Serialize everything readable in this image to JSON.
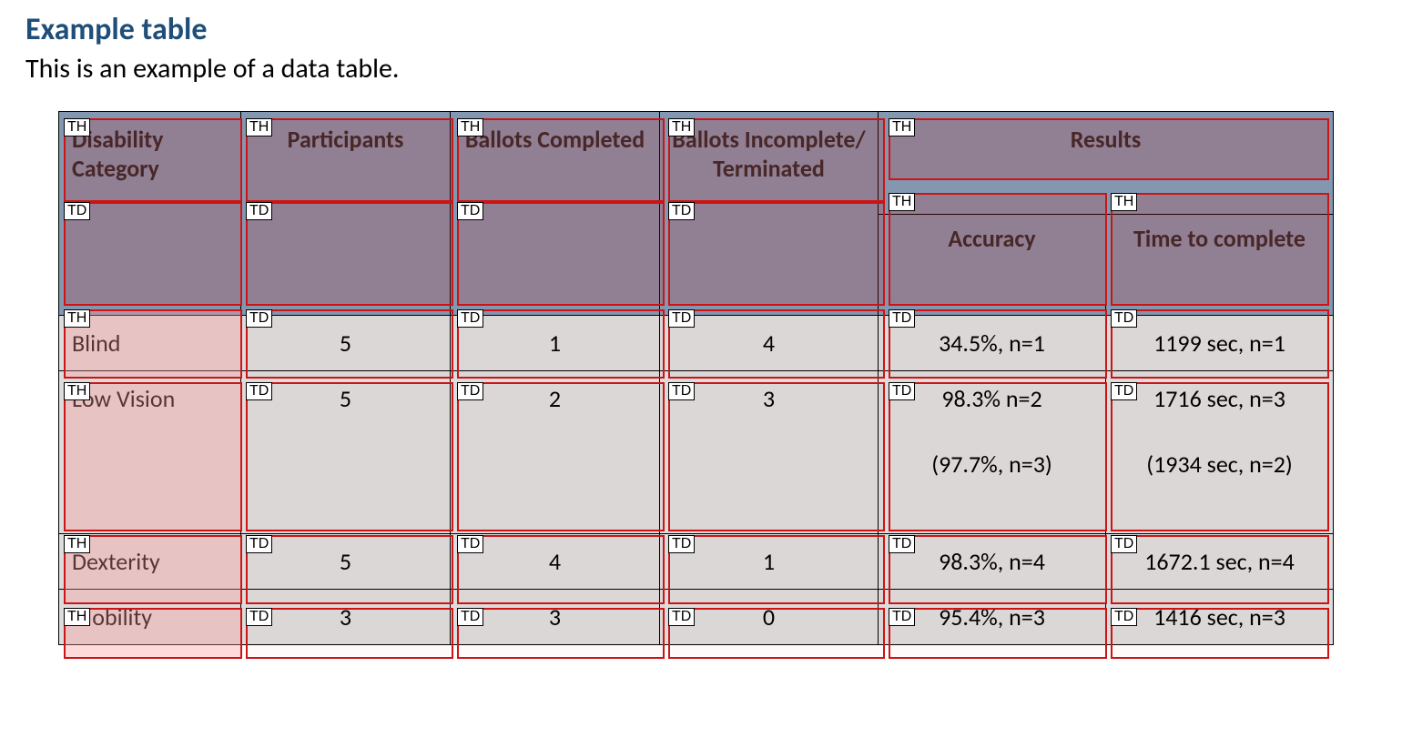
{
  "title": "Example table",
  "caption": "This is an example of a data table.",
  "headers": {
    "col1": "Disability Category",
    "col2": "Participants",
    "col3": "Ballots Completed",
    "col4": "Ballots Incomplete/ Terminated",
    "results_group": "Results",
    "col5": "Accuracy",
    "col6": "Time to complete"
  },
  "rows": [
    {
      "category": "Blind",
      "participants": "5",
      "completed": "1",
      "incomplete": "4",
      "accuracy": "34.5%, n=1",
      "time": "1199 sec, n=1"
    },
    {
      "category": "Low Vision",
      "participants": "5",
      "completed": "2",
      "incomplete": "3",
      "accuracy": "98.3% n=2",
      "accuracy_sub": "(97.7%, n=3)",
      "time": "1716 sec, n=3",
      "time_sub": "(1934 sec, n=2)"
    },
    {
      "category": "Dexterity",
      "participants": "5",
      "completed": "4",
      "incomplete": "1",
      "accuracy": "98.3%, n=4",
      "time": "1672.1 sec, n=4"
    },
    {
      "category": "Mobility",
      "participants": "3",
      "completed": "3",
      "incomplete": "0",
      "accuracy": "95.4%, n=3",
      "time": "1416 sec, n=3"
    }
  ],
  "tags": {
    "th": "TH",
    "td": "TD"
  },
  "chart_data": {
    "type": "table",
    "title": "Example table",
    "columns": [
      "Disability Category",
      "Participants",
      "Ballots Completed",
      "Ballots Incomplete/Terminated",
      "Accuracy",
      "Time to complete"
    ],
    "rows": [
      [
        "Blind",
        5,
        1,
        4,
        "34.5%, n=1",
        "1199 sec, n=1"
      ],
      [
        "Low Vision",
        5,
        2,
        3,
        "98.3% n=2 (97.7%, n=3)",
        "1716 sec, n=3 (1934 sec, n=2)"
      ],
      [
        "Dexterity",
        5,
        4,
        1,
        "98.3%, n=4",
        "1672.1 sec, n=4"
      ],
      [
        "Mobility",
        3,
        3,
        0,
        "95.4%, n=3",
        "1416 sec, n=3"
      ]
    ]
  }
}
